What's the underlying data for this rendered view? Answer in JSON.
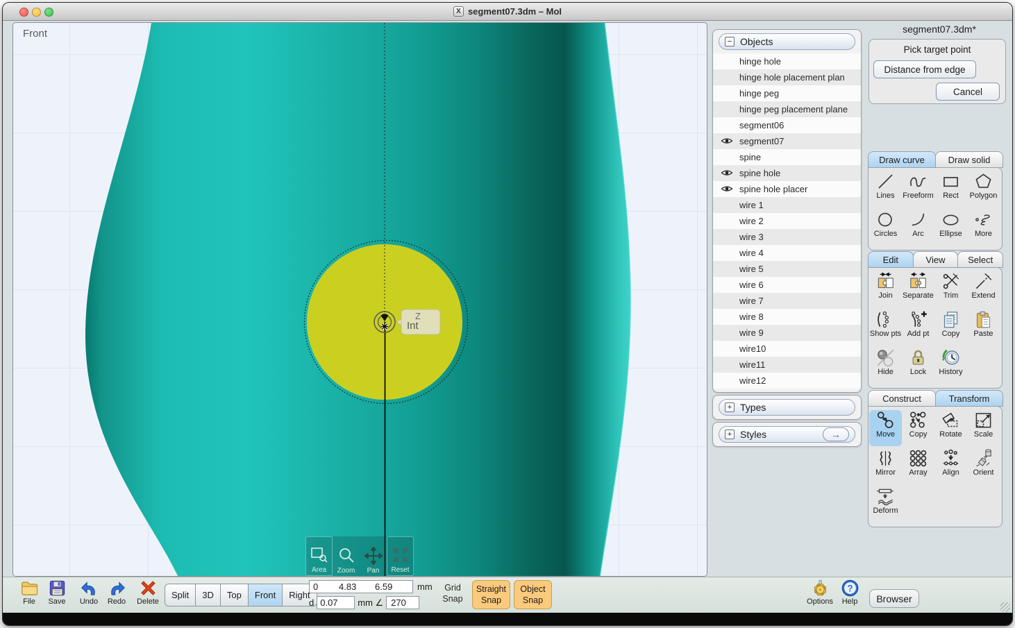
{
  "window": {
    "title": "segment07.3dm – MoI",
    "app_icon_glyph": "X"
  },
  "viewport": {
    "view_label": "Front",
    "snap_tooltip": "Int",
    "axis_hint": "Z",
    "overlay_buttons": [
      "Area",
      "Zoom",
      "Pan",
      "Reset"
    ]
  },
  "objects_panel": {
    "header": "Objects",
    "collapse_glyph": "−",
    "expand_glyph": "+",
    "items": [
      {
        "label": "hinge hole",
        "visible": false
      },
      {
        "label": "hinge hole placement plan",
        "visible": false
      },
      {
        "label": "hinge peg",
        "visible": false
      },
      {
        "label": "hinge peg placement plane",
        "visible": false
      },
      {
        "label": "segment06",
        "visible": false
      },
      {
        "label": "segment07",
        "visible": true
      },
      {
        "label": "spine",
        "visible": false
      },
      {
        "label": "spine hole",
        "visible": true
      },
      {
        "label": "spine hole placer",
        "visible": true
      },
      {
        "label": "wire 1",
        "visible": false
      },
      {
        "label": "wire 2",
        "visible": false
      },
      {
        "label": "wire 3",
        "visible": false
      },
      {
        "label": "wire 4",
        "visible": false
      },
      {
        "label": "wire 5",
        "visible": false
      },
      {
        "label": "wire 6",
        "visible": false
      },
      {
        "label": "wire 7",
        "visible": false
      },
      {
        "label": "wire 8",
        "visible": false
      },
      {
        "label": "wire 9",
        "visible": false
      },
      {
        "label": "wire10",
        "visible": false
      },
      {
        "label": "wire11",
        "visible": false
      },
      {
        "label": "wire12",
        "visible": false
      }
    ],
    "types_header": "Types",
    "styles_header": "Styles",
    "styles_arrow": "→"
  },
  "command_panel": {
    "doc_title": "segment07.3dm*",
    "prompt": "Pick target point",
    "distance_button": "Distance from edge",
    "cancel_button": "Cancel"
  },
  "draw_panel": {
    "tabs": [
      "Draw curve",
      "Draw solid"
    ],
    "active_tab": "Draw curve",
    "tools": [
      "Lines",
      "Freeform",
      "Rect",
      "Polygon",
      "Circles",
      "Arc",
      "Ellipse",
      "More"
    ]
  },
  "edit_panel": {
    "tabs": [
      "Edit",
      "View",
      "Select"
    ],
    "active_tab": "Edit",
    "tools": [
      "Join",
      "Separate",
      "Trim",
      "Extend",
      "Show pts",
      "Add pt",
      "Copy",
      "Paste",
      "Hide",
      "Lock",
      "History"
    ]
  },
  "construct_panel": {
    "tabs": [
      "Construct",
      "Transform"
    ],
    "active_tab": "Transform",
    "selected_tool": "Move",
    "tools": [
      "Move",
      "Copy",
      "Rotate",
      "Scale",
      "Mirror",
      "Array",
      "Align",
      "Orient",
      "Deform"
    ]
  },
  "toolbar": {
    "file": "File",
    "save": "Save",
    "undo": "Undo",
    "redo": "Redo",
    "delete": "Delete",
    "view_buttons": [
      "Split",
      "3D",
      "Top",
      "Front",
      "Right"
    ],
    "active_view": "Front",
    "coords": {
      "x": "0",
      "y": "4.83",
      "z": "6.59",
      "unit": "mm",
      "d_label": "d",
      "d_value": "0.07",
      "angle_prefix": "mm ∠",
      "angle_value": "270"
    },
    "snaps": {
      "grid": "Grid Snap",
      "straight": "Straight Snap",
      "object": "Object Snap"
    },
    "options": "Options",
    "help": "Help",
    "browser": "Browser"
  },
  "colors": {
    "teal": "#18b2a8",
    "circle_yellow": "#cbd020",
    "tab_active": "#aed3ef",
    "snap_orange": "#fbca7c"
  }
}
